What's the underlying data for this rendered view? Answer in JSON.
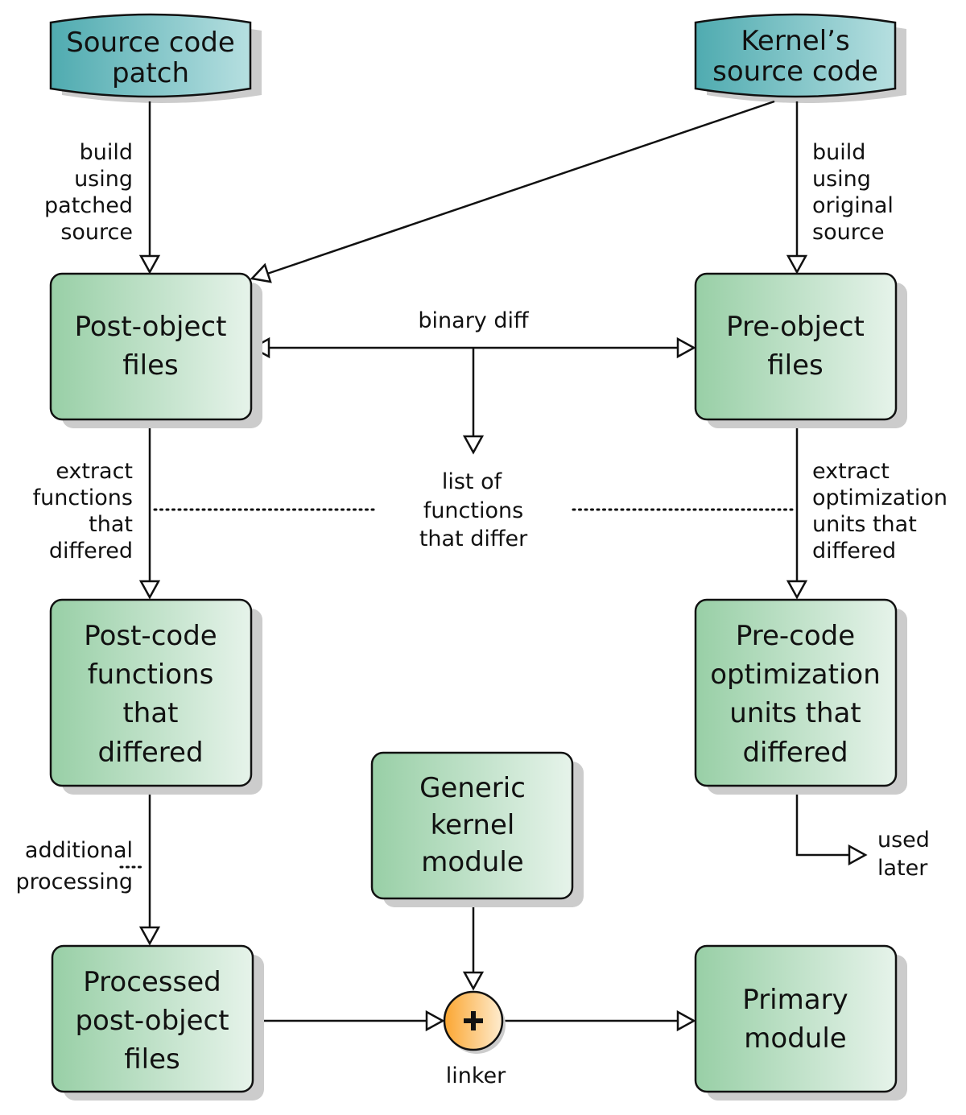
{
  "diagram": {
    "sources": {
      "patch": {
        "lines": [
          "Source code",
          "patch"
        ]
      },
      "kernel": {
        "lines": [
          "Kernel’s",
          "source code"
        ]
      }
    },
    "nodes": {
      "post_object": {
        "lines": [
          "Post-object",
          "files"
        ]
      },
      "pre_object": {
        "lines": [
          "Pre-object",
          "files"
        ]
      },
      "post_code": {
        "lines": [
          "Post-code",
          "functions",
          "that",
          "differed"
        ]
      },
      "pre_code": {
        "lines": [
          "Pre-code",
          "optimization",
          "units that",
          "differed"
        ]
      },
      "generic_module": {
        "lines": [
          "Generic",
          "kernel",
          "module"
        ]
      },
      "processed": {
        "lines": [
          "Processed",
          "post-object",
          "files"
        ]
      },
      "primary": {
        "lines": [
          "Primary",
          "module"
        ]
      }
    },
    "linker": {
      "symbol": "+",
      "label": "linker"
    },
    "edge_labels": {
      "build_patched": [
        "build",
        "using",
        "patched",
        "source"
      ],
      "build_original": [
        "build",
        "using",
        "original",
        "source"
      ],
      "binary_diff": [
        "binary diff"
      ],
      "list_of_functions": [
        "list of",
        "functions",
        "that differ"
      ],
      "extract_functions": [
        "extract",
        "functions",
        "that",
        "differed"
      ],
      "extract_units": [
        "extract",
        "optimization",
        "units that",
        "differed"
      ],
      "additional_processing": [
        "additional",
        "processing"
      ],
      "used_later": [
        "used",
        "later"
      ]
    },
    "colors": {
      "source_gradient": [
        "#4fabb0",
        "#b6dfe0"
      ],
      "node_gradient": [
        "#98cfa6",
        "#e6f3ea"
      ],
      "linker_gradient": [
        "#fba631",
        "#feeccf"
      ]
    }
  }
}
